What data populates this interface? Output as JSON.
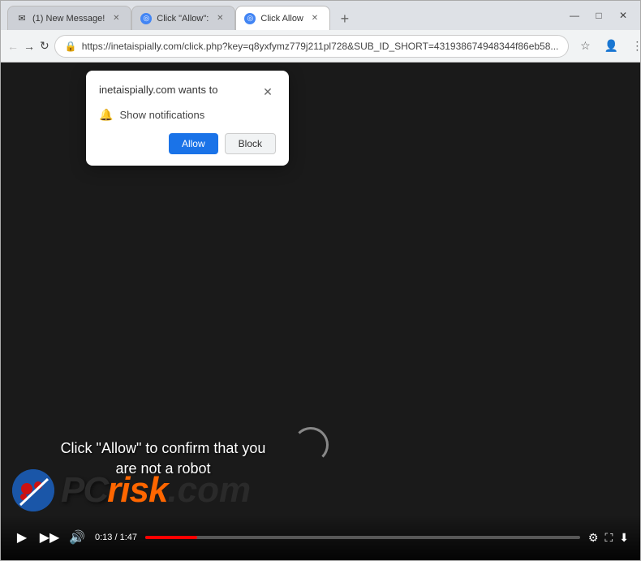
{
  "tabs": [
    {
      "id": "tab1",
      "label": "(1) New Message!",
      "favicon": "envelope",
      "active": false
    },
    {
      "id": "tab2",
      "label": "Click \"Allow\":",
      "favicon": "cursor",
      "active": false
    },
    {
      "id": "tab3",
      "label": "Click Allow",
      "favicon": "cursor",
      "active": true
    }
  ],
  "address_bar": {
    "url": "https://inetaispially.com/click.php?key=q8yxfymz779j211pl728&SUB_ID_SHORT=431938674948344f86eb58..."
  },
  "popup": {
    "title": "inetaispially.com wants to",
    "permission": "Show notifications",
    "allow_label": "Allow",
    "block_label": "Block"
  },
  "page": {
    "instruction_text": "Click \"Allow\" to confirm that you are not a robot",
    "video_time": "0:13 / 1:47"
  },
  "logo": {
    "pc": "PC",
    "risk": "risk",
    "com": ".com"
  }
}
